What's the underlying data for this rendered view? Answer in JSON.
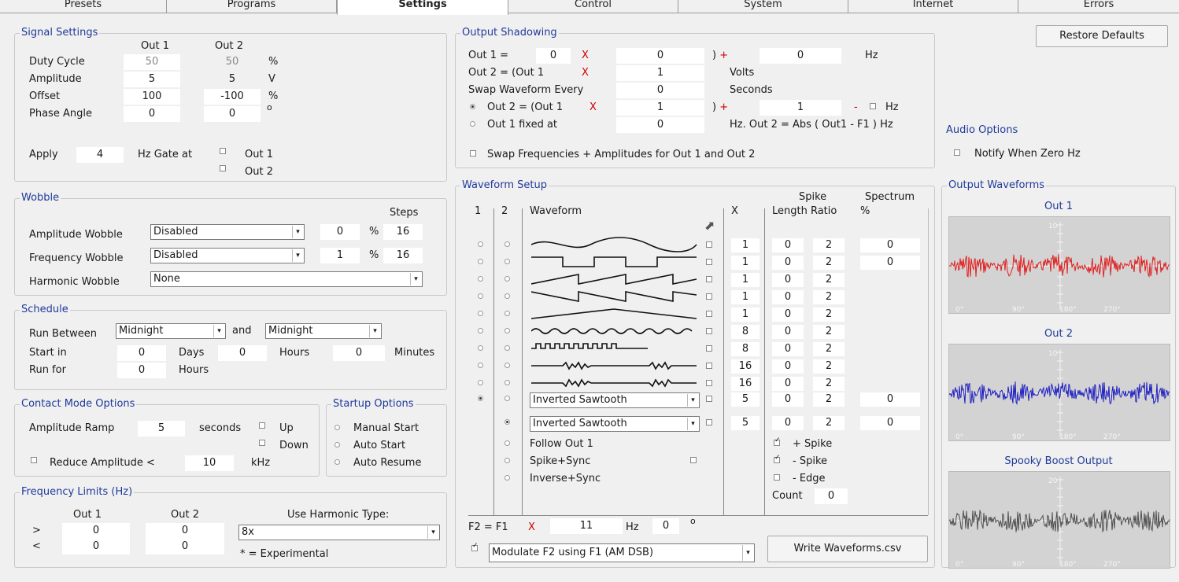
{
  "tabs": [
    "Presets",
    "Programs",
    "Settings",
    "Control",
    "System",
    "Internet",
    "Errors"
  ],
  "signal": {
    "title": "Signal Settings",
    "out1": "Out 1",
    "out2": "Out 2",
    "rows": [
      {
        "label": "Duty Cycle",
        "v1": "50",
        "v2": "50",
        "unit": "%"
      },
      {
        "label": "Amplitude",
        "v1": "5",
        "v2": "5",
        "unit": "V"
      },
      {
        "label": "Offset",
        "v1": "100",
        "v2": "-100",
        "unit": "%"
      },
      {
        "label": "Phase Angle",
        "v1": "0",
        "v2": "0",
        "unit": "o"
      }
    ],
    "apply": "Apply",
    "apply_value": "4",
    "gate": "Hz Gate at",
    "gate_out1": "Out 1",
    "gate_out2": "Out 2"
  },
  "wobble": {
    "title": "Wobble",
    "steps": "Steps",
    "rows": [
      {
        "label": "Amplitude Wobble",
        "mode": "Disabled",
        "value": "0",
        "unit": "%",
        "steps": "16"
      },
      {
        "label": "Frequency Wobble",
        "mode": "Disabled",
        "value": "1",
        "unit": "%",
        "steps": "16"
      }
    ],
    "harmonic_label": "Harmonic Wobble",
    "harmonic_value": "None"
  },
  "schedule": {
    "title": "Schedule",
    "run_between": "Run Between",
    "from": "Midnight",
    "and": "and",
    "to": "Midnight",
    "start_in": "Start in",
    "start_days": "0",
    "days": "Days",
    "start_hours": "0",
    "hours": "Hours",
    "start_minutes": "0",
    "minutes": "Minutes",
    "run_for": "Run for",
    "run_for_value": "0",
    "run_for_unit": "Hours"
  },
  "contact": {
    "title": "Contact Mode Options",
    "ramp": "Amplitude Ramp",
    "ramp_value": "5",
    "seconds": "seconds",
    "up": "Up",
    "down": "Down",
    "reduce": "Reduce Amplitude <",
    "reduce_value": "10",
    "khz": "kHz"
  },
  "startup": {
    "title": "Startup Options",
    "options": [
      "Manual Start",
      "Auto Start",
      "Auto Resume"
    ]
  },
  "freq": {
    "title": "Frequency Limits (Hz)",
    "out1": "Out 1",
    "out2": "Out 2",
    "gt": ">",
    "lt": "<",
    "gt1": "0",
    "gt2": "0",
    "lt1": "0",
    "lt2": "0",
    "harmonic_label": "Use Harmonic Type:",
    "harmonic_value": "8x",
    "experimental": "* = Experimental"
  },
  "shadow": {
    "title": "Output Shadowing",
    "r1_label": "Out 1 =",
    "r1_a": "0",
    "x": "X",
    "r1_b": "0",
    "paren_plus": ") +",
    "r1_c": "0",
    "hz": "Hz",
    "r2_label": "Out 2 = (Out 1",
    "r2_b": "1",
    "volts": "Volts",
    "r3_label": "Swap Waveform Every",
    "r3_b": "0",
    "seconds": "Seconds",
    "r4_label": "Out 2 = (Out 1",
    "r4_b": "1",
    "r4_c": "1",
    "minus": "-",
    "r5_label": "Out 1 fixed at",
    "r5_b": "0",
    "r5_text": "Hz. Out 2 = Abs ( Out1 - F1 ) Hz",
    "swap_freq": "Swap Frequencies + Amplitudes for Out 1 and Out 2"
  },
  "restore": "Restore Defaults",
  "audio": {
    "title": "Audio Options",
    "notify": "Notify When Zero Hz"
  },
  "waveform": {
    "title": "Waveform Setup",
    "col1": "1",
    "col2": "2",
    "col_wave": "Waveform",
    "col_x": "X",
    "spike": "Spike",
    "length_ratio": "Length Ratio",
    "spectrum": "Spectrum",
    "pct": "%",
    "x_values": [
      "1",
      "1",
      "1",
      "1",
      "1",
      "8",
      "8",
      "16",
      "16",
      "5",
      "5"
    ],
    "length": [
      "0",
      "0",
      "0",
      "0",
      "0",
      "0",
      "0",
      "0",
      "0",
      "0",
      "0"
    ],
    "ratio": [
      "2",
      "2",
      "2",
      "2",
      "2",
      "2",
      "2",
      "2",
      "2",
      "2",
      "2"
    ],
    "spectrum_values": [
      "0",
      "0",
      "0",
      "0"
    ],
    "custom1": "Inverted Sawtooth",
    "custom2": "Inverted Sawtooth",
    "extra": [
      "Follow Out 1",
      "Spike+Sync",
      "Inverse+Sync"
    ],
    "plus_spike": "+ Spike",
    "minus_spike": "- Spike",
    "minus_edge": "- Edge",
    "count": "Count",
    "count_value": "0",
    "f2": "F2 = F1",
    "f2_x": "X",
    "f2_value": "11",
    "f2_hz": "Hz",
    "f2_phase": "0",
    "f2_deg": "o",
    "modulate": "Modulate F2 using F1 (AM DSB)",
    "write": "Write Waveforms.csv"
  },
  "outputs": {
    "title": "Output Waveforms",
    "out1": "Out 1",
    "out2": "Out 2",
    "spooky": "Spooky Boost Output",
    "ticks": [
      "0°",
      "90°",
      "180°",
      "270°"
    ],
    "yt1": "10",
    "yt2": "10",
    "yt3": "20"
  },
  "colors": {
    "accent": "#1f3a9a",
    "red": "#d00000",
    "trace1": "#e02020",
    "trace2": "#2020c0",
    "trace3": "#505050"
  }
}
